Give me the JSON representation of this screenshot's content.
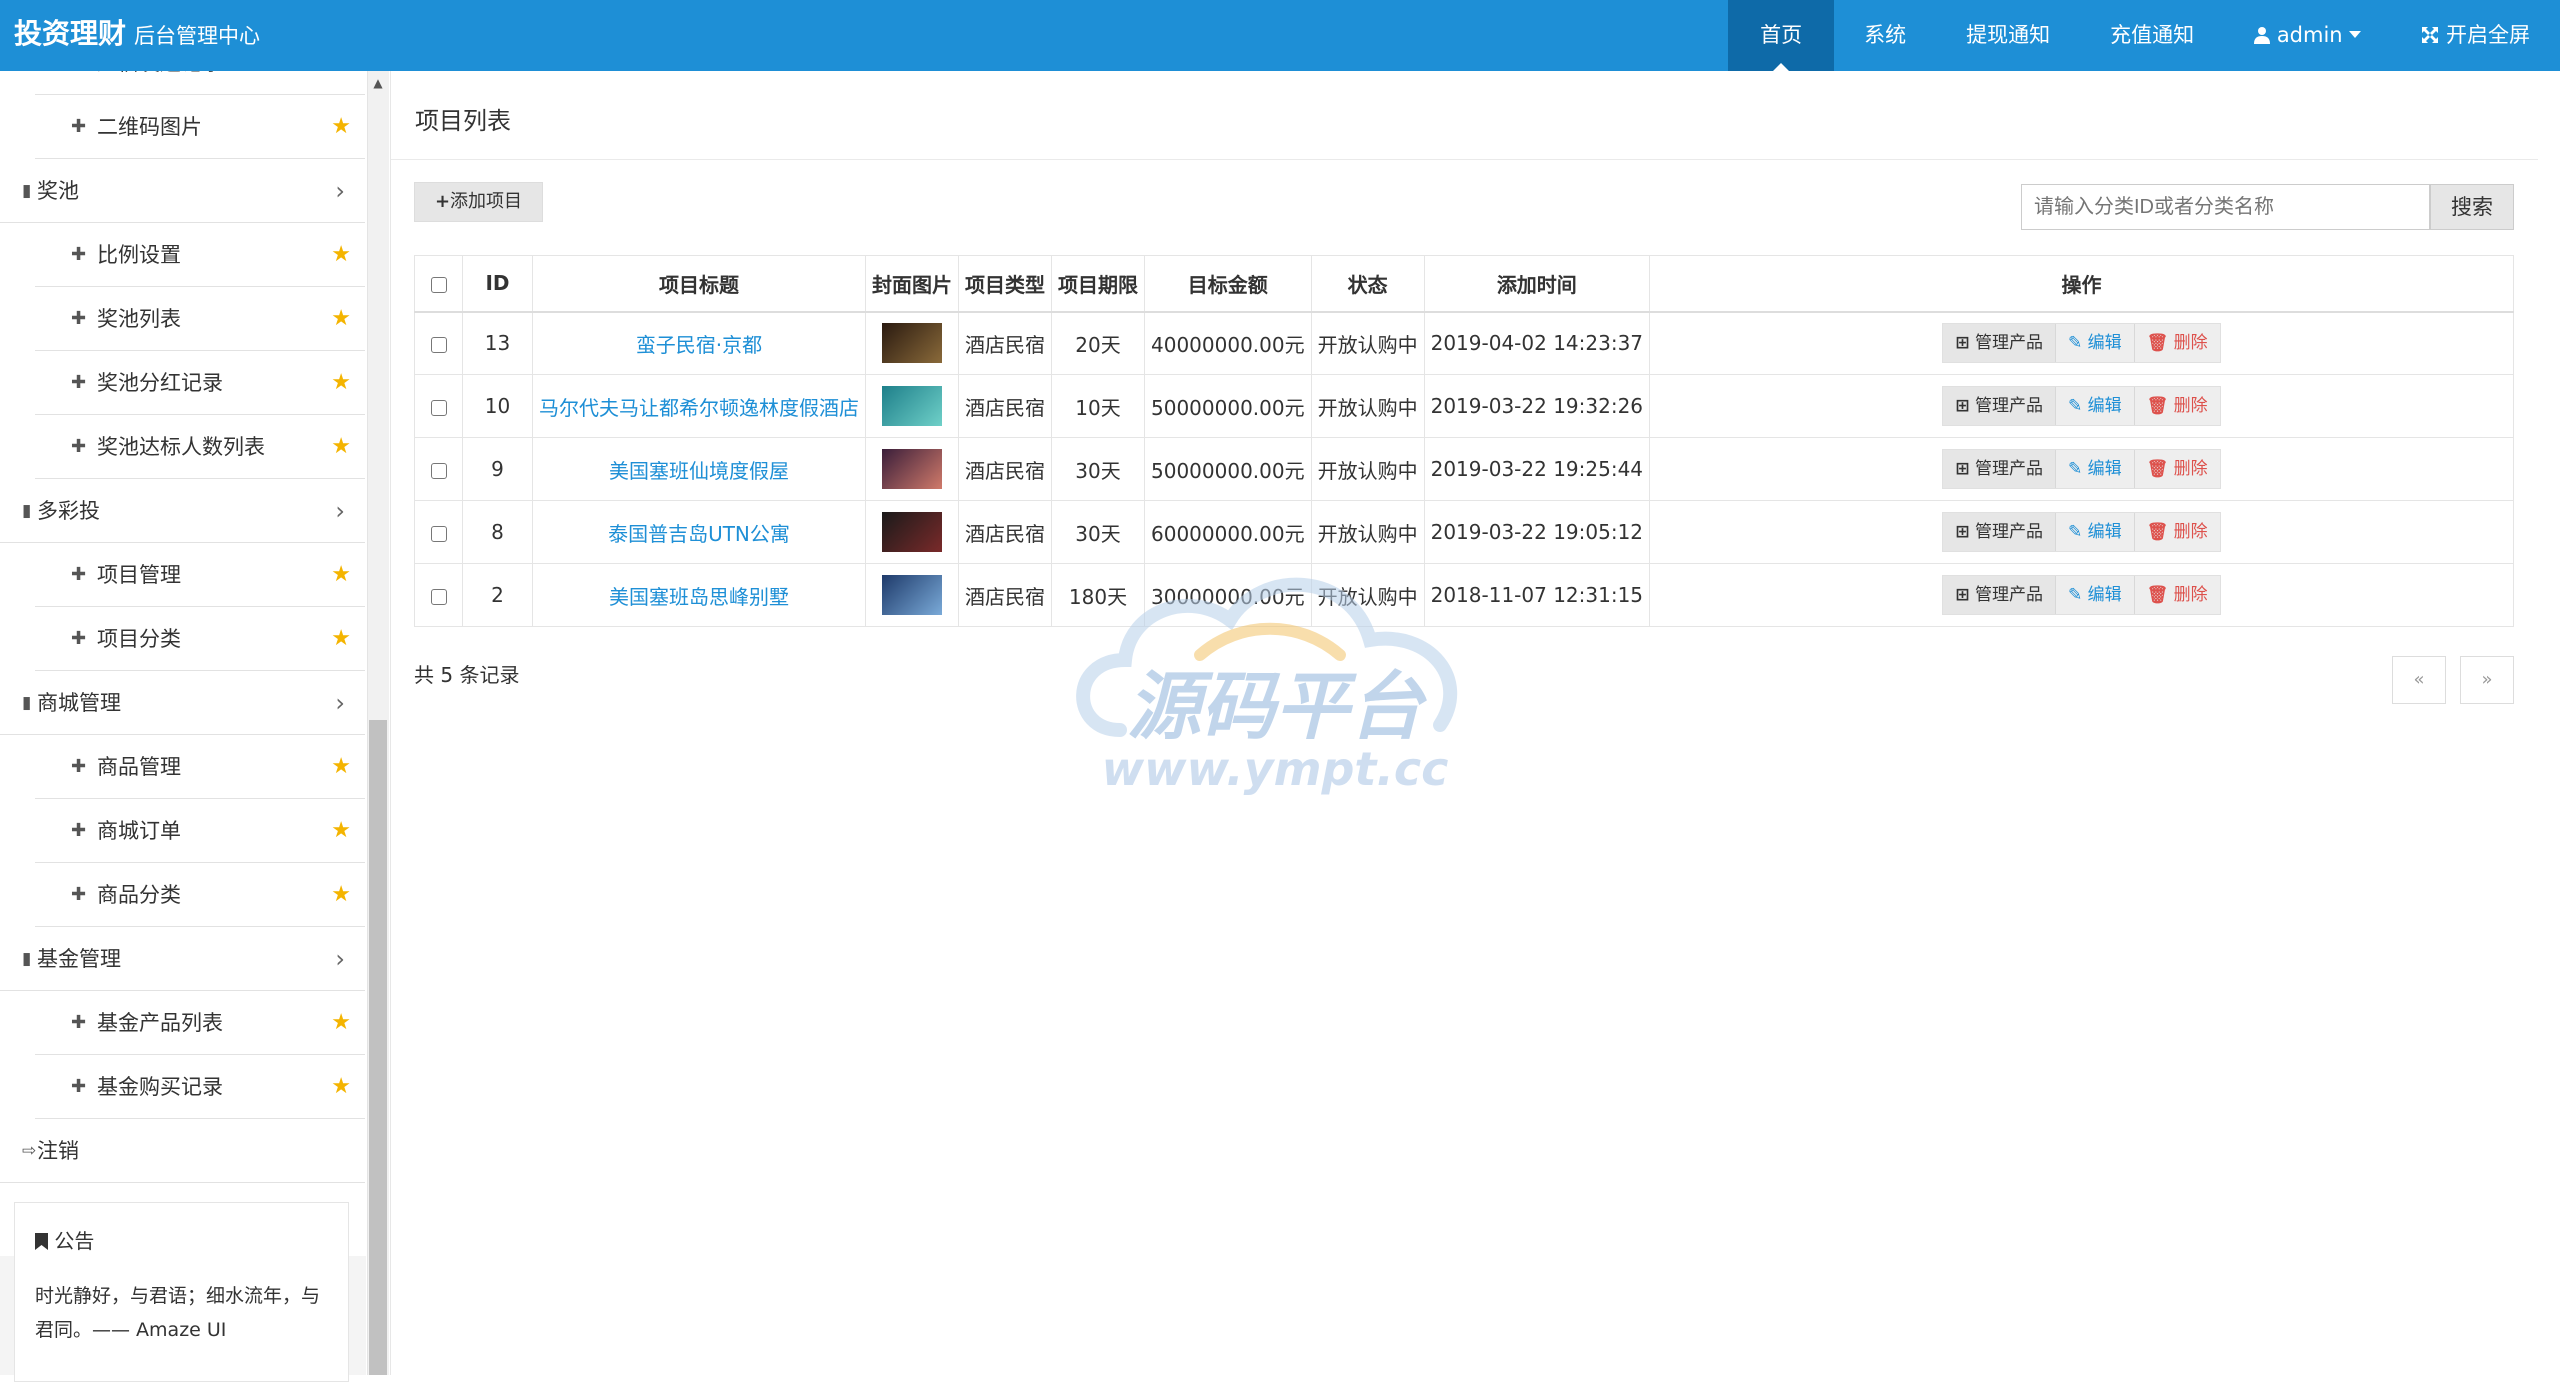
{
  "header": {
    "brand": "投资理财",
    "brand_sub": "后台管理中心",
    "nav": [
      {
        "label": "首页",
        "active": true
      },
      {
        "label": "系统"
      },
      {
        "label": "提现通知"
      },
      {
        "label": "充值通知"
      },
      {
        "label": "admin"
      },
      {
        "label": "开启全屏"
      }
    ]
  },
  "sidebar": {
    "partial_top": "短信发送记录",
    "rows": [
      {
        "label": "二维码图片",
        "type": "sub"
      },
      {
        "label": "奖池",
        "type": "group"
      },
      {
        "label": "比例设置",
        "type": "sub"
      },
      {
        "label": "奖池列表",
        "type": "sub"
      },
      {
        "label": "奖池分红记录",
        "type": "sub"
      },
      {
        "label": "奖池达标人数列表",
        "type": "sub"
      },
      {
        "label": "多彩投",
        "type": "group"
      },
      {
        "label": "项目管理",
        "type": "sub"
      },
      {
        "label": "项目分类",
        "type": "sub"
      },
      {
        "label": "商城管理",
        "type": "group"
      },
      {
        "label": "商品管理",
        "type": "sub"
      },
      {
        "label": "商城订单",
        "type": "sub"
      },
      {
        "label": "商品分类",
        "type": "sub"
      },
      {
        "label": "基金管理",
        "type": "group"
      },
      {
        "label": "基金产品列表",
        "type": "sub"
      },
      {
        "label": "基金购买记录",
        "type": "sub"
      },
      {
        "label": "注销",
        "type": "logout"
      }
    ],
    "notice": {
      "title": "公告",
      "body": "时光静好，与君语；细水流年，与君同。—— Amaze UI"
    }
  },
  "main": {
    "title": "项目列表",
    "add_button": "添加项目",
    "search_placeholder": "请输入分类ID或者分类名称",
    "search_button": "搜索",
    "columns": [
      "ID",
      "项目标题",
      "封面图片",
      "项目类型",
      "项目期限",
      "目标金额",
      "状态",
      "添加时间",
      "操作"
    ],
    "rows": [
      {
        "id": "13",
        "title": "蛮子民宿·京都",
        "type": "酒店民宿",
        "term": "20天",
        "amount": "40000000.00元",
        "status": "开放认购中",
        "time": "2019-04-02 14:23:37",
        "thumb": [
          "#2a1a10",
          "#8a6a3a"
        ]
      },
      {
        "id": "10",
        "title": "马尔代夫马让都希尔顿逸林度假酒店",
        "type": "酒店民宿",
        "term": "10天",
        "amount": "50000000.00元",
        "status": "开放认购中",
        "time": "2019-03-22 19:32:26",
        "thumb": [
          "#1e7f8a",
          "#6fd0c8"
        ]
      },
      {
        "id": "9",
        "title": "美国塞班仙境度假屋",
        "type": "酒店民宿",
        "term": "30天",
        "amount": "50000000.00元",
        "status": "开放认购中",
        "time": "2019-03-22 19:25:44",
        "thumb": [
          "#3a1e3a",
          "#d07a6a"
        ]
      },
      {
        "id": "8",
        "title": "泰国普吉岛UTN公寓",
        "type": "酒店民宿",
        "term": "30天",
        "amount": "60000000.00元",
        "status": "开放认购中",
        "time": "2019-03-22 19:05:12",
        "thumb": [
          "#1a1a1a",
          "#7a2a2a"
        ]
      },
      {
        "id": "2",
        "title": "美国塞班岛思峰别墅",
        "type": "酒店民宿",
        "term": "180天",
        "amount": "30000000.00元",
        "status": "开放认购中",
        "time": "2018-11-07 12:31:15",
        "thumb": [
          "#1e3a6a",
          "#7aaad8"
        ]
      }
    ],
    "ops": {
      "manage": "管理产品",
      "edit": "编辑",
      "delete": "删除"
    },
    "total": "共 5 条记录",
    "pager": {
      "prev": "«",
      "next": "»"
    }
  },
  "watermark": {
    "line1": "源码平台",
    "line2": "www.ympt.cc"
  },
  "colors": {
    "header": "#1e8fd6",
    "nav_active": "#0e6aa8",
    "link": "#1e8fd6",
    "star": "#f4b400",
    "delete": "#dd514c"
  }
}
